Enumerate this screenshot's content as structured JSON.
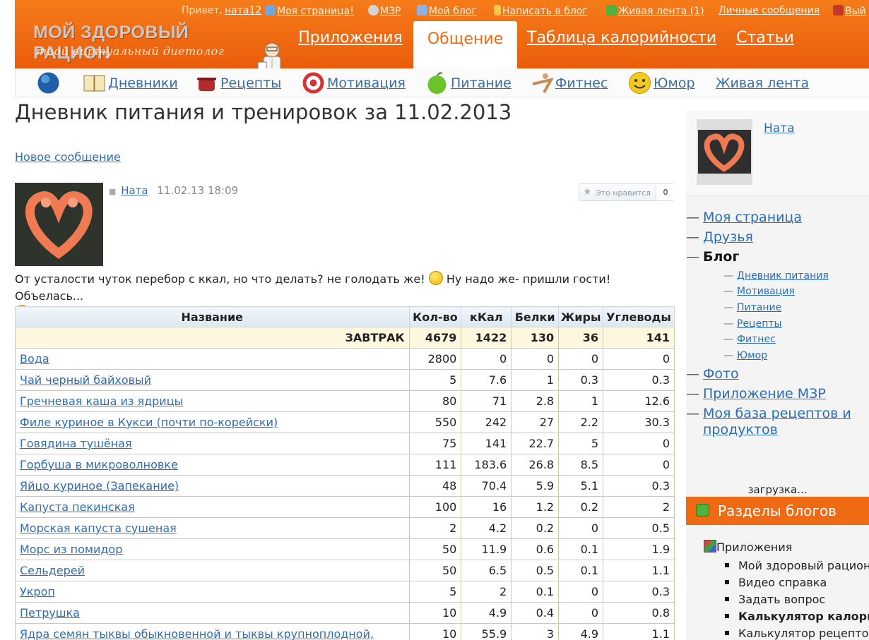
{
  "topbar": {
    "greeting": "Привет,",
    "user": "ната12",
    "my_page": "Моя страница!",
    "mzr": "МЗР",
    "my_blog": "Мой блог",
    "write_blog": "Написать в блог",
    "live_feed": "Живая лента (1)",
    "messages": "Личные сообщения",
    "logout": "Вый"
  },
  "logo": {
    "title": "МОЙ ЗДОРОВЫЙ РАЦИОН",
    "subtitle": "твой виртуальный диетолог"
  },
  "main_nav": [
    "Приложения",
    "Общение",
    "Таблица калорийности",
    "Статьи"
  ],
  "sub_nav": [
    "Дневники",
    "Рецепты",
    "Мотивация",
    "Питание",
    "Фитнес",
    "Юмор",
    "Живая лента"
  ],
  "page": {
    "title": "Дневник питания и тренировок за 11.02.2013",
    "new_message": "Новое сообщение"
  },
  "post": {
    "author": "Ната",
    "date": "11.02.13 18:09",
    "like_label": "Это нравится",
    "like_count": "0",
    "text_part1": "От усталости чуток перебор с ккал, но что делать? не голодать же!",
    "text_part2": "Ну надо же- пришли гости! Объелась..."
  },
  "table": {
    "headers": [
      "Название",
      "Кол-во",
      "кКал",
      "Белки",
      "Жиры",
      "Углеводы"
    ],
    "group": {
      "name": "ЗАВТРАК",
      "qty": "4679",
      "kcal": "1422",
      "protein": "130",
      "fat": "36",
      "carbs": "141"
    },
    "rows": [
      [
        "Вода",
        "2800",
        "0",
        "0",
        "0",
        "0"
      ],
      [
        "Чай черный байховый",
        "5",
        "7.6",
        "1",
        "0.3",
        "0.3"
      ],
      [
        "Гречневая каша из ядрицы",
        "80",
        "71",
        "2.8",
        "1",
        "12.6"
      ],
      [
        "Филе куриное в Кукси (почти по-корейски)",
        "550",
        "242",
        "27",
        "2.2",
        "30.3"
      ],
      [
        "Говядина тушёная",
        "75",
        "141",
        "22.7",
        "5",
        "0"
      ],
      [
        "Горбуша в микроволновке",
        "111",
        "183.6",
        "26.8",
        "8.5",
        "0"
      ],
      [
        "Яйцо куриное (Запекание)",
        "48",
        "70.4",
        "5.9",
        "5.1",
        "0.3"
      ],
      [
        "Капуста пекинская",
        "100",
        "16",
        "1.2",
        "0.2",
        "2"
      ],
      [
        "Морская капуста сушеная",
        "2",
        "4.2",
        "0.2",
        "0",
        "0.5"
      ],
      [
        "Морс из помидор",
        "50",
        "11.9",
        "0.6",
        "0.1",
        "1.9"
      ],
      [
        "Сельдерей",
        "50",
        "6.5",
        "0.5",
        "0.1",
        "1.1"
      ],
      [
        "Укроп",
        "5",
        "2",
        "0.1",
        "0",
        "0.3"
      ],
      [
        "Петрушка",
        "10",
        "4.9",
        "0.4",
        "0",
        "0.8"
      ],
      [
        "Ядра семян тыквы обыкновенной и тыквы крупноплодной,",
        "10",
        "55.9",
        "3",
        "4.9",
        "1.1"
      ]
    ]
  },
  "sidebar": {
    "name": "Ната",
    "menu": [
      "Моя страница",
      "Друзья",
      "Блог"
    ],
    "blog_sub": [
      "Дневник питания",
      "Мотивация",
      "Питание",
      "Рецепты",
      "Фитнес",
      "Юмор"
    ],
    "menu2": [
      "Фото",
      "Приложение МЗР",
      "Моя база рецептов и",
      "продуктов"
    ],
    "loading": "загрузка...",
    "blogs_header": "Разделы блогов",
    "apps_label": "Приложения",
    "apps": [
      "Мой здоровый рацион",
      "Видео справка",
      "Задать вопрос",
      "Калькулятор калори",
      "Калькулятор рецептов"
    ]
  },
  "colors": {
    "accent": "#f06a14",
    "link": "#2a6eb5"
  }
}
